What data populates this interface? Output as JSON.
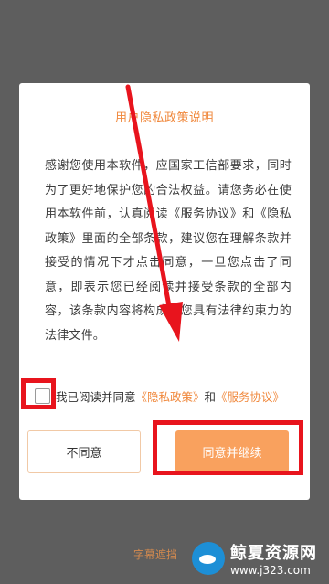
{
  "dialog": {
    "title": "用户隐私政策说明",
    "body": "感谢您使用本软件，应国家工信部要求，同时为了更好地保护您的合法权益。请您务必在使用本软件前，认真阅读《服务协议》和《隐私政策》里面的全部条款，建议您在理解条款并接受的情况下才点击同意，一旦您点击了同意，即表示您已经阅读并接受条款的全部内容，该条款内容将构成对您具有法律约束力的法律文件。",
    "agree_prefix": "我已阅读并同意",
    "privacy_link": "《隐私政策》",
    "and_text": "和",
    "service_link": "《服务协议》",
    "checkbox_checked": false,
    "disagree_label": "不同意",
    "agree_label": "同意并继续"
  },
  "footer": {
    "partial_text": "字幕遮挡",
    "logo_name": "鲸夏资源网",
    "logo_url": "www.j323.com"
  },
  "colors": {
    "accent": "#f0883c",
    "agree_button": "#f9a15e",
    "annotation": "#e8141d",
    "backdrop": "#5e5e5e"
  }
}
